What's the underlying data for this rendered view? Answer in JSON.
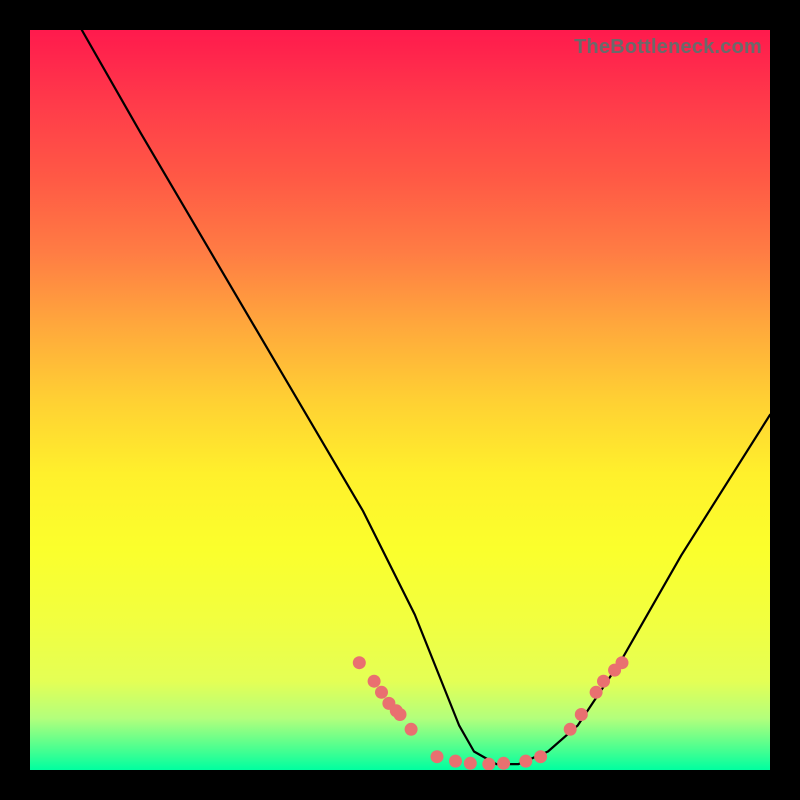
{
  "watermark": "TheBottleneck.com",
  "chart_data": {
    "type": "line",
    "title": "",
    "xlabel": "",
    "ylabel": "",
    "xlim": [
      0,
      100
    ],
    "ylim": [
      0,
      100
    ],
    "series": [
      {
        "name": "curve",
        "x": [
          7,
          15,
          25,
          35,
          45,
          52,
          56,
          58,
          60,
          63,
          66,
          70,
          74,
          80,
          88,
          100
        ],
        "y": [
          100,
          86,
          69,
          52,
          35,
          21,
          11,
          6,
          2.5,
          0.8,
          0.8,
          2.5,
          6,
          15,
          29,
          48
        ]
      }
    ],
    "markers": {
      "name": "dots",
      "x": [
        44.5,
        46.5,
        47.5,
        48.5,
        49.5,
        50.0,
        51.5,
        55.0,
        57.5,
        59.5,
        62.0,
        64.0,
        67.0,
        69.0,
        73.0,
        74.5,
        76.5,
        77.5,
        79.0,
        80.0
      ],
      "y": [
        14.5,
        12.0,
        10.5,
        9.0,
        8.0,
        7.5,
        5.5,
        1.8,
        1.2,
        0.9,
        0.8,
        0.9,
        1.2,
        1.8,
        5.5,
        7.5,
        10.5,
        12.0,
        13.5,
        14.5
      ]
    }
  }
}
